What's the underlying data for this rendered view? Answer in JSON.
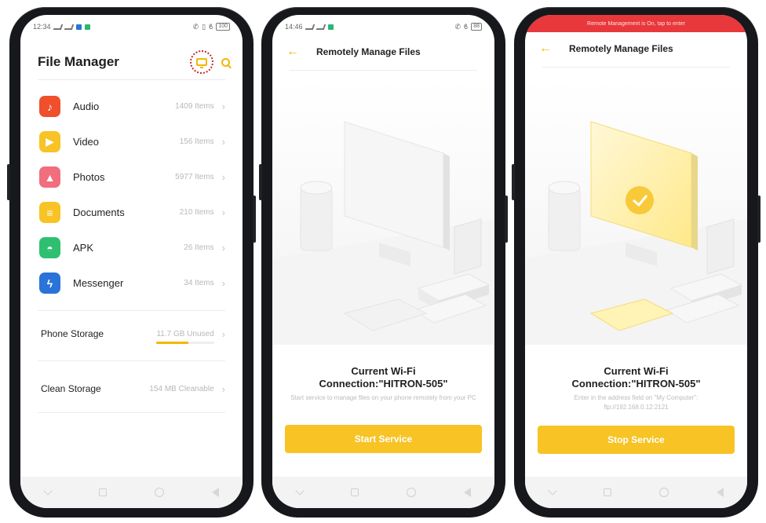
{
  "phone1": {
    "status": {
      "time": "12:34",
      "battery": "100"
    },
    "title": "File Manager",
    "categories": [
      {
        "label": "Audio",
        "count": "1409 Items",
        "color": "#ef4f2a",
        "icon": "music-note-icon",
        "glyph": "♪"
      },
      {
        "label": "Video",
        "count": "156 Items",
        "color": "#f7c325",
        "icon": "play-icon",
        "glyph": "▶"
      },
      {
        "label": "Photos",
        "count": "5977 Items",
        "color": "#f16e7d",
        "icon": "photo-icon",
        "glyph": "▲"
      },
      {
        "label": "Documents",
        "count": "210 Items",
        "color": "#f7c325",
        "icon": "document-icon",
        "glyph": "≡"
      },
      {
        "label": "APK",
        "count": "26 Items",
        "color": "#2fbf71",
        "icon": "android-icon",
        "glyph": "◓"
      },
      {
        "label": "Messenger",
        "count": "34 Items",
        "color": "#2a73d8",
        "icon": "messenger-icon",
        "glyph": "ϟ"
      }
    ],
    "phone_storage": {
      "label": "Phone Storage",
      "value": "11.7 GB Unused",
      "used_fraction": 0.55
    },
    "clean_storage": {
      "label": "Clean Storage",
      "value": "154 MB Cleanable"
    }
  },
  "phone2": {
    "status": {
      "time": "14:46",
      "battery": "88"
    },
    "title": "Remotely Manage Files",
    "wifi_line1": "Current Wi-Fi",
    "wifi_line2": "Connection:\"HITRON-505\"",
    "hint": "Start service to manage files on your phone remotely from your PC",
    "button": "Start Service"
  },
  "phone3": {
    "banner": "Remote Management is On, tap to enter",
    "title": "Remotely Manage Files",
    "wifi_line1": "Current Wi-Fi",
    "wifi_line2": "Connection:\"HITRON-505\"",
    "hint": "Enter in the address field on \"My Computer\":",
    "address": "ftp://192.168.0.12:2121",
    "button": "Stop Service"
  },
  "colors": {
    "accent": "#f7c325",
    "banner": "#e8383b"
  }
}
